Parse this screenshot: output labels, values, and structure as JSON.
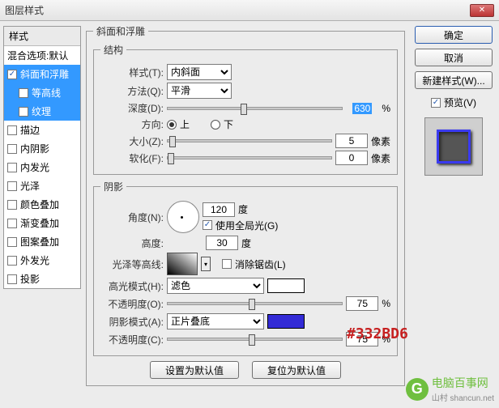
{
  "title": "图层样式",
  "styles": {
    "header": "样式",
    "blend": "混合选项:默认",
    "items": [
      {
        "label": "斜面和浮雕",
        "chk": true,
        "sel": true
      },
      {
        "label": "等高线",
        "chk": false,
        "sel": true,
        "indent": true
      },
      {
        "label": "纹理",
        "chk": false,
        "sel": true,
        "indent": true
      },
      {
        "label": "描边",
        "chk": false
      },
      {
        "label": "内阴影",
        "chk": false
      },
      {
        "label": "内发光",
        "chk": false
      },
      {
        "label": "光泽",
        "chk": false
      },
      {
        "label": "颜色叠加",
        "chk": false
      },
      {
        "label": "渐变叠加",
        "chk": false
      },
      {
        "label": "图案叠加",
        "chk": false
      },
      {
        "label": "外发光",
        "chk": false
      },
      {
        "label": "投影",
        "chk": false
      }
    ]
  },
  "bevel": {
    "legend": "斜面和浮雕",
    "struct": {
      "legend": "结构",
      "style_lbl": "样式(T):",
      "style_val": "内斜面",
      "tech_lbl": "方法(Q):",
      "tech_val": "平滑",
      "depth_lbl": "深度(D):",
      "depth_val": "630",
      "pct": "%",
      "dir_lbl": "方向:",
      "up": "上",
      "down": "下",
      "size_lbl": "大小(Z):",
      "size_val": "5",
      "px": "像素",
      "soft_lbl": "软化(F):",
      "soft_val": "0"
    },
    "shade": {
      "legend": "阴影",
      "angle_lbl": "角度(N):",
      "angle_val": "120",
      "deg": "度",
      "global": "使用全局光(G)",
      "alt_lbl": "高度:",
      "alt_val": "30",
      "gloss_lbl": "光泽等高线:",
      "anti": "消除锯齿(L)",
      "hi_lbl": "高光模式(H):",
      "hi_val": "滤色",
      "hi_op_lbl": "不透明度(O):",
      "hi_op_val": "75",
      "sh_lbl": "阴影模式(A):",
      "sh_val": "正片叠底",
      "sh_color": "#332BD6",
      "sh_op_lbl": "不透明度(C):",
      "sh_op_val": "75"
    },
    "btn_default": "设置为默认值",
    "btn_reset": "复位为默认值"
  },
  "right": {
    "ok": "确定",
    "cancel": "取消",
    "newstyle": "新建样式(W)...",
    "preview": "预览(V)"
  },
  "hex_label": "#332BD6",
  "watermark": {
    "brand": "电脑百事网",
    "sub": "山村 shancun.net"
  }
}
